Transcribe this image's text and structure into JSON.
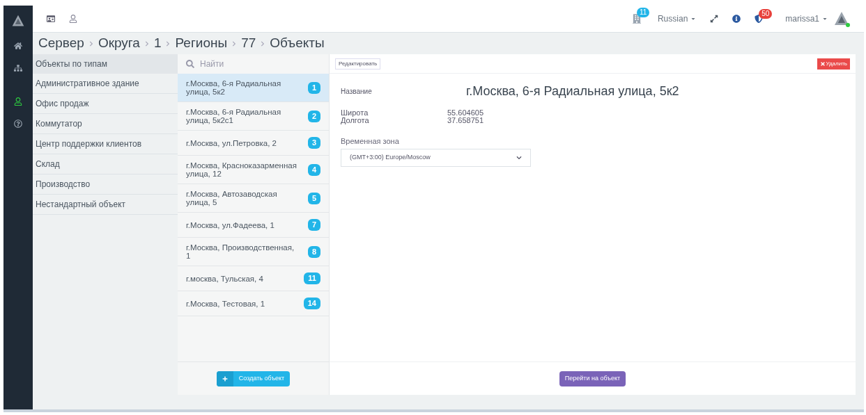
{
  "nav": [
    {
      "kind": "home",
      "selected": false
    },
    {
      "kind": "sitemap",
      "selected": false
    },
    {
      "kind": "user",
      "selected": true
    },
    {
      "kind": "help",
      "selected": false
    }
  ],
  "topbar": {
    "notifications": "11",
    "language": "Russian",
    "alerts": "50",
    "user": "marissa1"
  },
  "breadcrumb": [
    "Сервер",
    "Округа",
    "1",
    "Регионы",
    "77",
    "Объекты"
  ],
  "categories": {
    "title": "Объекты по типам",
    "items": [
      "Административное здание",
      "Офис продаж",
      "Коммутатор",
      "Центр поддержки клиентов",
      "Склад",
      "Производство",
      "Нестандартный объект"
    ]
  },
  "objects": {
    "search_placeholder": "Найти",
    "create_button": "Создать объект",
    "items": [
      {
        "name": "г.Москва, 6-я Радиальная улица, 5к2",
        "count": "1",
        "selected": true
      },
      {
        "name": "г.Москва, 6-я Радиальная улица, 5к2с1",
        "count": "2",
        "selected": false
      },
      {
        "name": "г.Москва, ул.Петровка, 2",
        "count": "3",
        "selected": false
      },
      {
        "name": "г.Москва, Красноказарменная улица, 12",
        "count": "4",
        "selected": false
      },
      {
        "name": "г.Москва, Автозаводская улица, 5",
        "count": "5",
        "selected": false
      },
      {
        "name": "г.Москва, ул.Фадеева, 1",
        "count": "7",
        "selected": false
      },
      {
        "name": "г.Москва, Производственная, 1",
        "count": "8",
        "selected": false
      },
      {
        "name": "г.москва, Тульская, 4",
        "count": "11",
        "selected": false
      },
      {
        "name": "г.Москва, Тестовая, 1",
        "count": "14",
        "selected": false
      }
    ]
  },
  "detail": {
    "edit_button": "Редактировать",
    "delete_button": "Удалить",
    "name_label": "Название",
    "name": "г.Москва, 6-я Радиальная улица, 5к2",
    "latitude_label": "Широта",
    "latitude": "55.604605",
    "longitude_label": "Долгота",
    "longitude": "37.658751",
    "timezone_label": "Временная зона",
    "timezone": "(GMT+3:00) Europe/Moscow",
    "go_button": "Перейти на объект"
  }
}
